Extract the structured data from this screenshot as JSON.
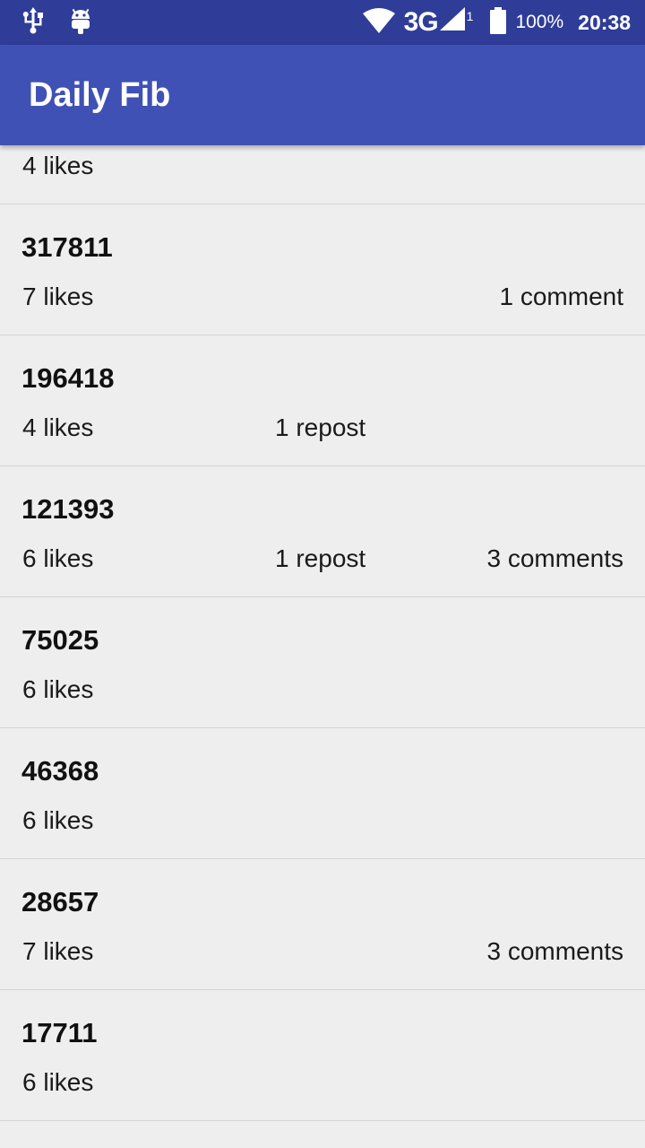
{
  "status_bar": {
    "network": "3G",
    "signal_sub": "1",
    "battery": "100%",
    "time": "20:38"
  },
  "app_bar": {
    "title": "Daily Fib"
  },
  "posts": [
    {
      "number": "",
      "likes": "4 likes",
      "reposts": "",
      "comments": ""
    },
    {
      "number": "317811",
      "likes": "7 likes",
      "reposts": "",
      "comments": "1 comment"
    },
    {
      "number": "196418",
      "likes": "4 likes",
      "reposts": "1 repost",
      "comments": ""
    },
    {
      "number": "121393",
      "likes": "6 likes",
      "reposts": "1 repost",
      "comments": "3 comments"
    },
    {
      "number": "75025",
      "likes": "6 likes",
      "reposts": "",
      "comments": ""
    },
    {
      "number": "46368",
      "likes": "6 likes",
      "reposts": "",
      "comments": ""
    },
    {
      "number": "28657",
      "likes": "7 likes",
      "reposts": "",
      "comments": "3 comments"
    },
    {
      "number": "17711",
      "likes": "6 likes",
      "reposts": "",
      "comments": ""
    }
  ]
}
